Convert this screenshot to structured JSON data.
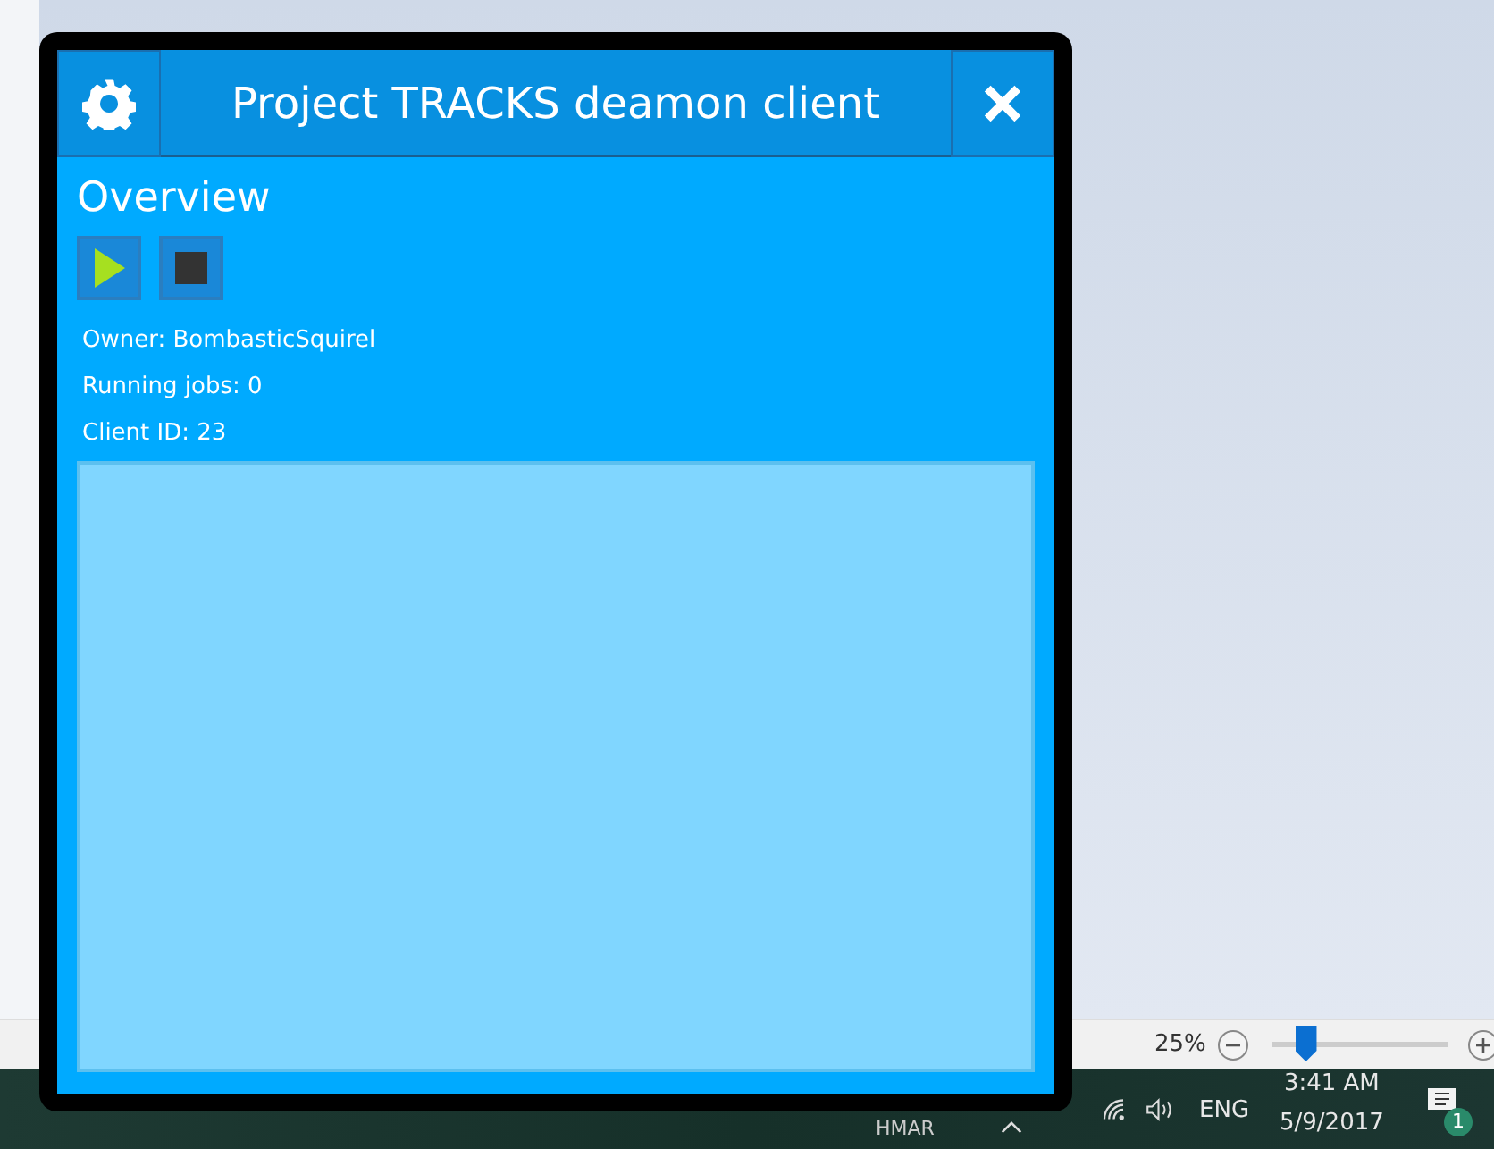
{
  "window": {
    "title": "Project TRACKS deamon client",
    "heading": "Overview",
    "info": [
      "Owner: BombasticSquirel",
      "Running jobs: 0",
      "Client ID: 23"
    ]
  },
  "status_bar": {
    "zoom": "25%",
    "zoom_slider": {
      "level": 0.13
    }
  },
  "taskbar": {
    "app_label": "HMAR",
    "language": "ENG",
    "time": "3:41 AM",
    "date": "5/9/2017",
    "notification_count": "1"
  }
}
